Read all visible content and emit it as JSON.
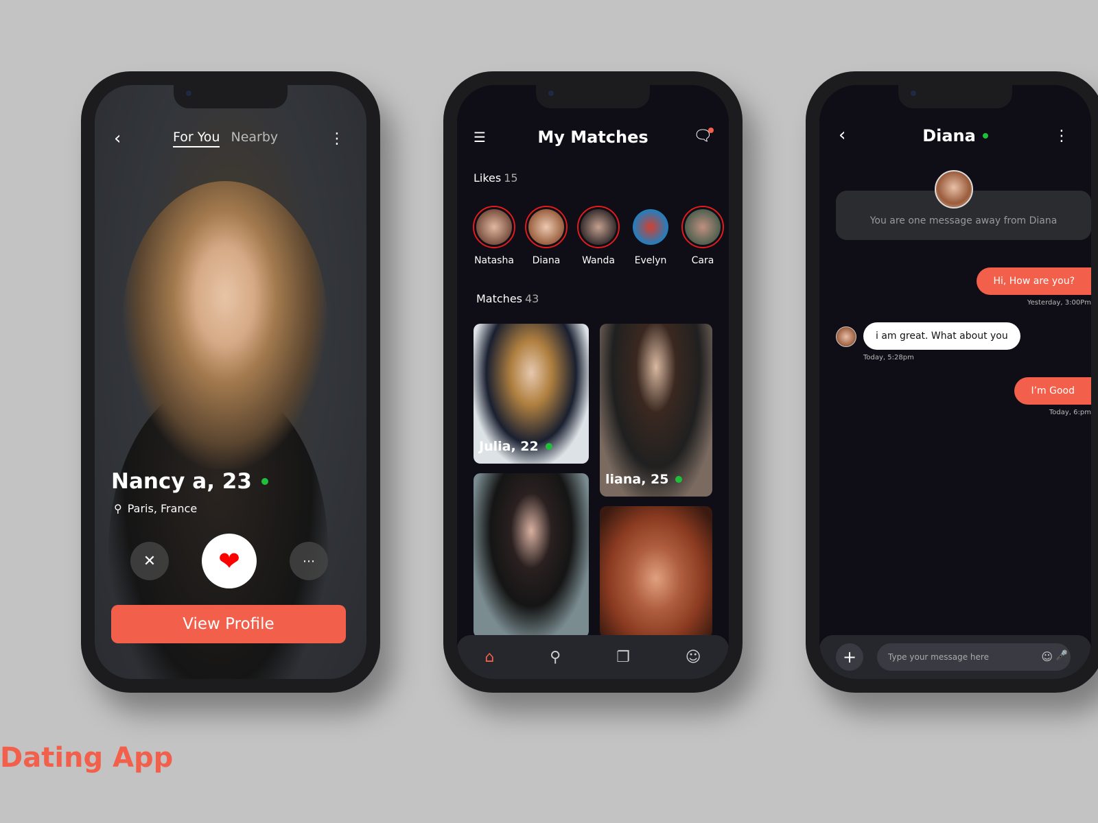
{
  "brand_title": "Dating App",
  "accent": "#f2604b",
  "online_color": "#1fbf3a",
  "discover": {
    "tabs": [
      {
        "label": "For You",
        "active": true
      },
      {
        "label": "Nearby",
        "active": false
      }
    ],
    "profile_name": "Nancy a, 23",
    "location": "Paris, France",
    "actions": [
      "close-icon",
      "heart-icon",
      "chat-icon"
    ],
    "view_profile_label": "View Profile"
  },
  "matches_screen": {
    "title": "My Matches",
    "likes_label": "Likes",
    "likes_count": "15",
    "likes": [
      {
        "name": "Natasha"
      },
      {
        "name": "Diana"
      },
      {
        "name": "Wanda"
      },
      {
        "name": "Evelyn"
      },
      {
        "name": "Cara"
      }
    ],
    "matches_label": "Matches",
    "matches_count": "43",
    "cards": [
      {
        "label": "Julia, 22",
        "online": true
      },
      {
        "label": "liana, 25",
        "online": true
      }
    ],
    "nav": [
      "home-icon",
      "location-icon",
      "cards-icon",
      "profile-icon"
    ]
  },
  "chat_screen": {
    "contact": "Diana",
    "banner": "You are one message away from Diana",
    "messages": [
      {
        "from": "me",
        "text": "Hi, How are you?",
        "time": "Yesterday, 3:00Pm"
      },
      {
        "from": "them",
        "text": "i am great. What about you",
        "time": "Today, 5:28pm"
      },
      {
        "from": "me",
        "text": "I’m Good",
        "time": "Today, 6:pm"
      }
    ],
    "input_placeholder": "Type your message here"
  }
}
